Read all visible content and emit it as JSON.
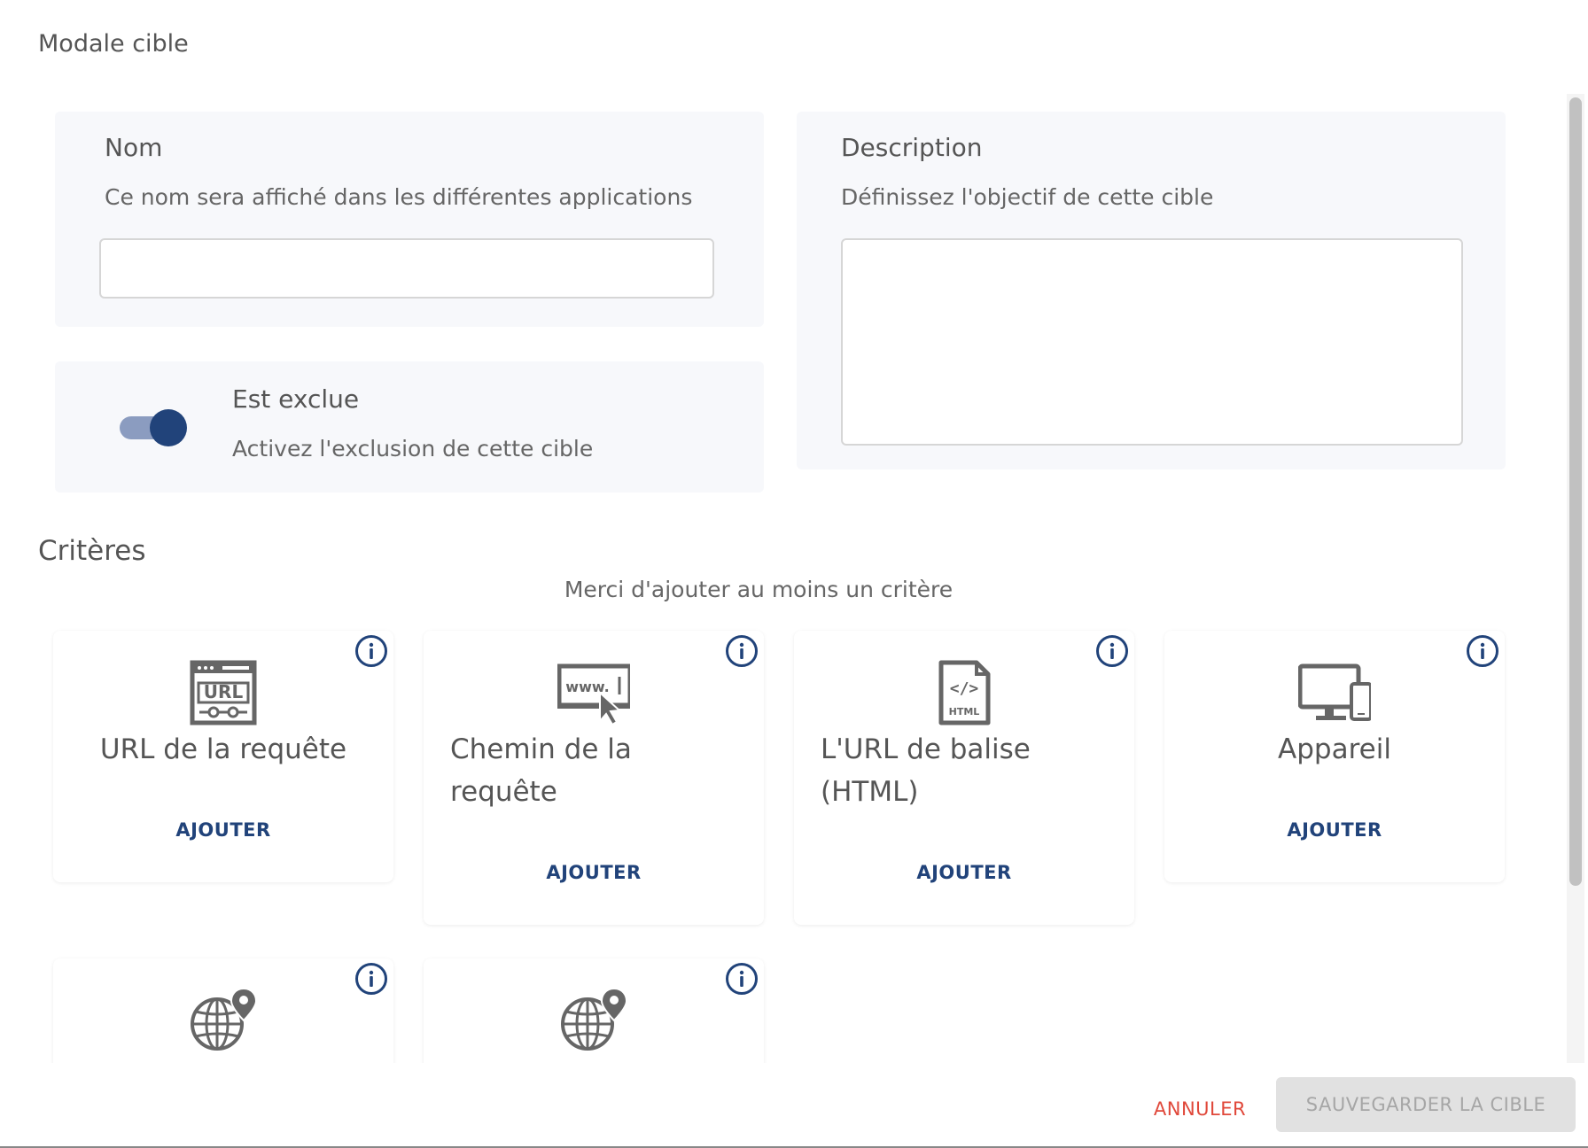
{
  "modal": {
    "title": "Modale cible"
  },
  "nom": {
    "heading": "Nom",
    "subtitle": "Ce nom sera affiché dans les différentes applications",
    "value": ""
  },
  "description": {
    "heading": "Description",
    "subtitle": "Définissez l'objectif de cette cible",
    "value": ""
  },
  "exclusion": {
    "heading": "Est exclue",
    "subtitle": "Activez l'exclusion de cette cible",
    "enabled": true
  },
  "criteria": {
    "title": "Critères",
    "hint": "Merci d'ajouter au moins un critère",
    "cards": [
      {
        "label": "URL de la requête",
        "icon": "url-browser-icon",
        "add_label": "AJOUTER"
      },
      {
        "label": "Chemin de la requête",
        "icon": "www-cursor-icon",
        "add_label": "AJOUTER"
      },
      {
        "label": "L'URL de balise (HTML)",
        "icon": "html-file-icon",
        "add_label": "AJOUTER"
      },
      {
        "label": "Appareil",
        "icon": "devices-icon",
        "add_label": "AJOUTER"
      },
      {
        "label": "",
        "icon": "globe-pin-icon",
        "add_label": ""
      },
      {
        "label": "",
        "icon": "globe-pin-icon",
        "add_label": ""
      }
    ]
  },
  "footer": {
    "cancel_label": "ANNULER",
    "save_label": "SAUVEGARDER LA CIBLE"
  },
  "colors": {
    "accent": "#21437a",
    "cancel": "#e0483a",
    "panel_bg": "#f7f8fb",
    "disabled_bg": "#e1e1e1"
  }
}
